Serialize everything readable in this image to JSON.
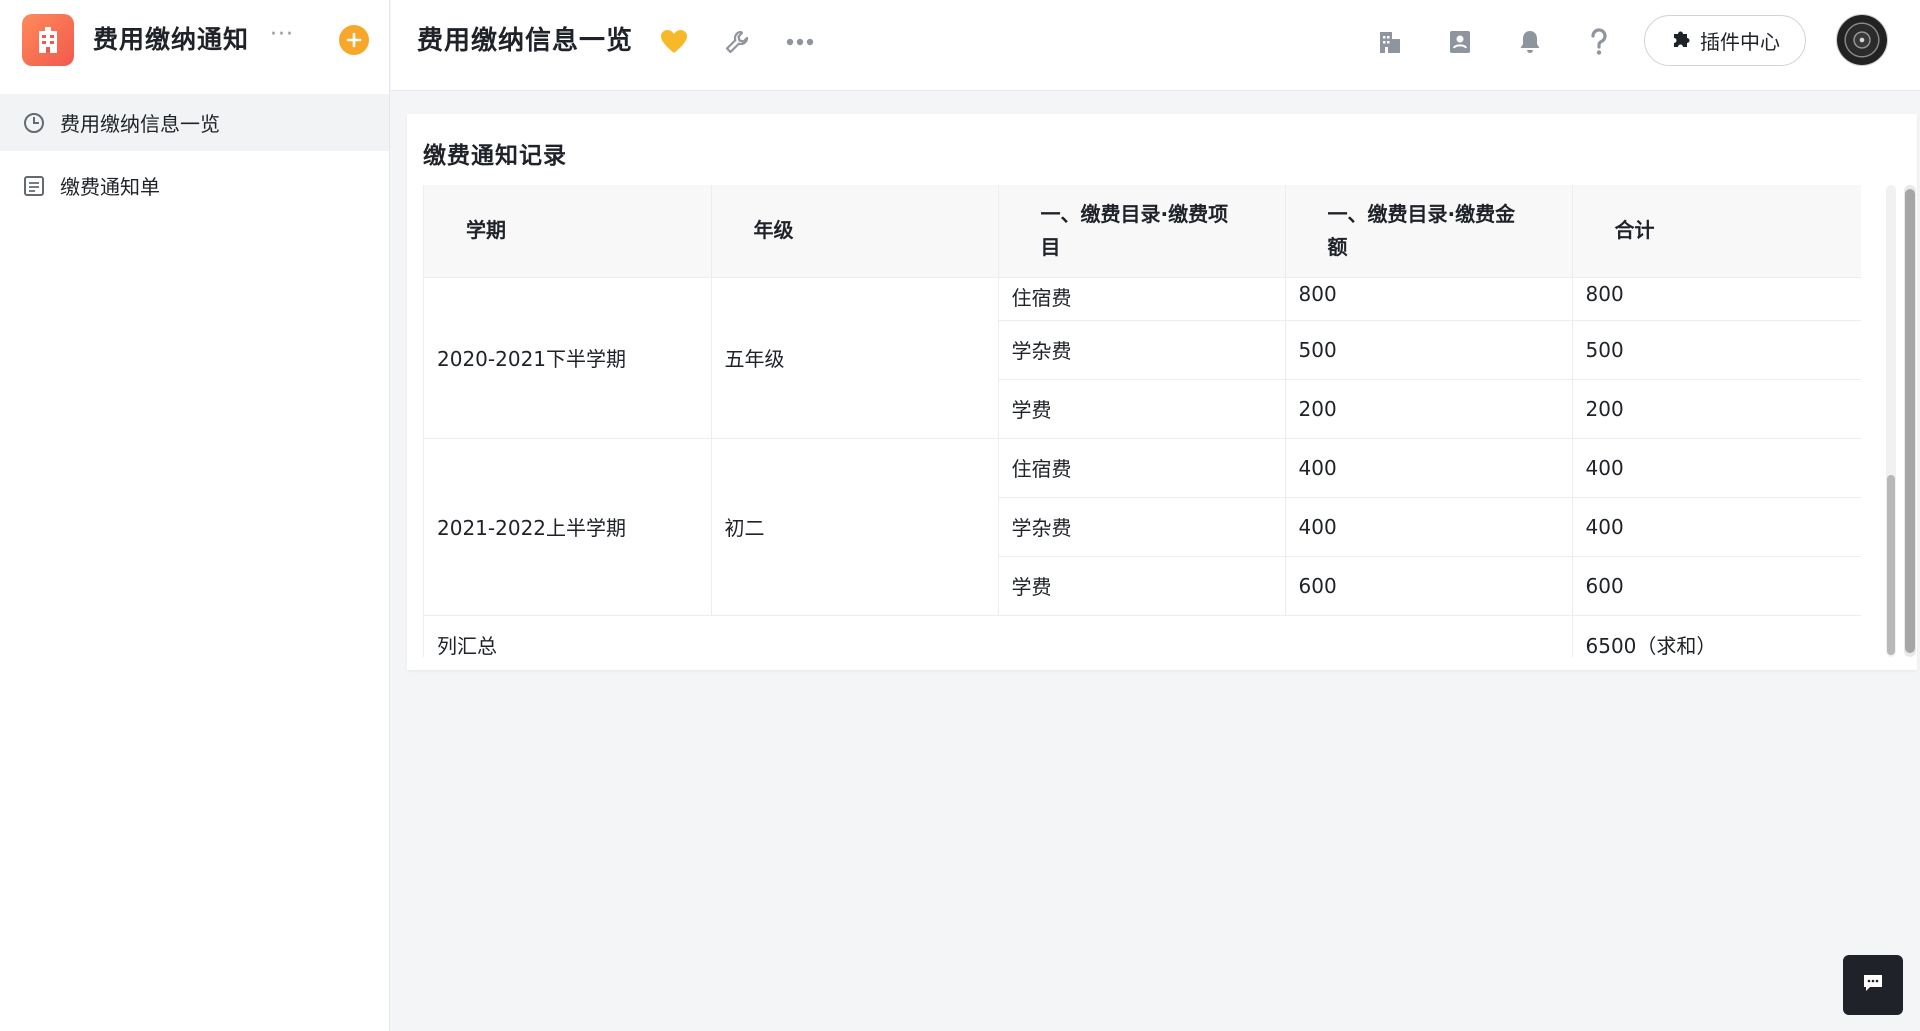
{
  "app": {
    "title": "费用缴纳通知",
    "more": "···"
  },
  "sidebar": {
    "items": [
      {
        "label": "费用缴纳信息一览",
        "icon": "clock-icon",
        "active": true
      },
      {
        "label": "缴费通知单",
        "icon": "form-icon",
        "active": false
      }
    ]
  },
  "topbar": {
    "page_title": "费用缴纳信息一览",
    "plugin_label": "插件中心"
  },
  "panel": {
    "title": "缴费通知记录",
    "columns": [
      "学期",
      "年级",
      "一、缴费目录·缴费项目",
      "一、缴费目录·缴费金额",
      "合计"
    ],
    "groups": [
      {
        "term": "2020-2021下半学期",
        "grade": "五年级",
        "rows": [
          {
            "item": "住宿费",
            "amount": "800",
            "total": "800"
          },
          {
            "item": "学杂费",
            "amount": "500",
            "total": "500"
          },
          {
            "item": "学费",
            "amount": "200",
            "total": "200"
          }
        ]
      },
      {
        "term": "2021-2022上半学期",
        "grade": "初二",
        "rows": [
          {
            "item": "住宿费",
            "amount": "400",
            "total": "400"
          },
          {
            "item": "学杂费",
            "amount": "400",
            "total": "400"
          },
          {
            "item": "学费",
            "amount": "600",
            "total": "600"
          }
        ]
      }
    ],
    "summary": {
      "label": "列汇总",
      "total": "6500（求和）"
    }
  },
  "colors": {
    "accent": "#f7a82b",
    "brand": "#f1594d",
    "heart": "#f7b928",
    "text": "#1f2329"
  }
}
